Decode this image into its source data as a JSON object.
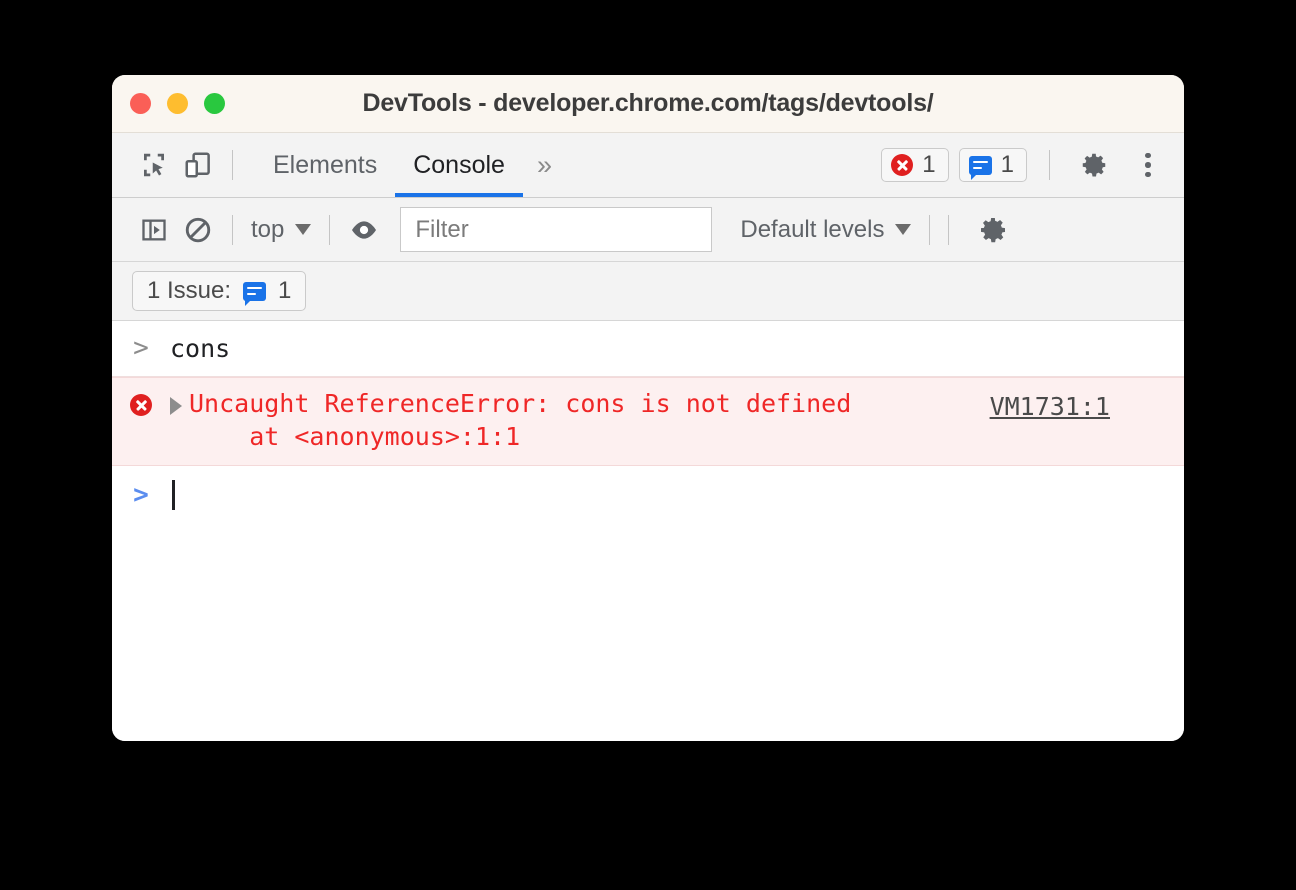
{
  "window": {
    "title": "DevTools - developer.chrome.com/tags/devtools/",
    "traffic_lights": {
      "close": "close-window",
      "minimize": "minimize-window",
      "maximize": "maximize-window"
    },
    "colors": {
      "titlebar_bg": "#faf6f0",
      "toolbar_bg": "#f3f3f3",
      "accent_blue": "#1a73e8",
      "error_red": "#ef2727",
      "error_row_bg": "#fdf0f0",
      "error_icon_red": "#e02020",
      "page_bg": "#000000"
    }
  },
  "main_toolbar": {
    "inspect_icon": "inspect-element-icon",
    "device_icon": "device-toolbar-icon",
    "tabs": [
      {
        "label": "Elements",
        "active": false
      },
      {
        "label": "Console",
        "active": true
      }
    ],
    "more_tabs_label": "»",
    "error_badge": {
      "icon": "error-icon",
      "count": "1"
    },
    "issues_badge": {
      "icon": "issues-icon",
      "count": "1"
    },
    "settings_icon": "gear-icon",
    "more_options_icon": "kebab-menu-icon"
  },
  "console_toolbar": {
    "sidebar_toggle_icon": "console-sidebar-icon",
    "clear_console_icon": "clear-console-icon",
    "context_selector": "top",
    "eye_icon": "live-expression-icon",
    "filter": {
      "placeholder": "Filter",
      "value": ""
    },
    "levels_selector": "Default levels",
    "settings_icon": "gear-icon"
  },
  "issues_bar": {
    "label": "1 Issue:",
    "icon": "issues-icon",
    "count": "1"
  },
  "console": {
    "input_row": {
      "prompt": ">",
      "text": "cons"
    },
    "error_row": {
      "icon": "error-icon",
      "expander": "collapsed-triangle-icon",
      "message": "Uncaught ReferenceError: cons is not defined",
      "stack": "    at <anonymous>:1:1",
      "source_link": "VM1731:1"
    },
    "prompt_row": {
      "prompt": ">",
      "value": ""
    }
  }
}
